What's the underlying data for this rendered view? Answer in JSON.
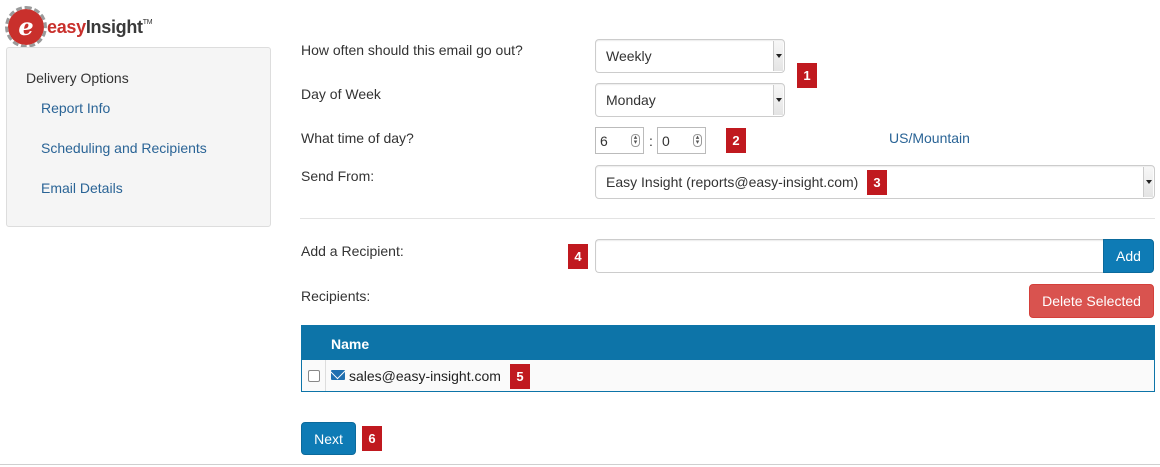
{
  "brand": {
    "logo_text": "easyInsight",
    "logo_easy": "easy",
    "logo_insight": "Insight",
    "tm": "TM"
  },
  "sidebar": {
    "heading": "Delivery Options",
    "items": [
      {
        "label": "Report Info"
      },
      {
        "label": "Scheduling and Recipients"
      },
      {
        "label": "Email Details"
      }
    ]
  },
  "form": {
    "frequency": {
      "label": "How often should this email go out?",
      "value": "Weekly"
    },
    "day_of_week": {
      "label": "Day of Week",
      "value": "Monday"
    },
    "time_of_day": {
      "label": "What time of day?",
      "hour": "6",
      "separator": ":",
      "minute": "0",
      "timezone": "US/Mountain"
    },
    "send_from": {
      "label": "Send From:",
      "value": "Easy Insight (reports@easy-insight.com)"
    },
    "add_recipient": {
      "label": "Add a Recipient:",
      "value": "",
      "button": "Add"
    },
    "recipients": {
      "label": "Recipients:",
      "delete_button": "Delete Selected"
    }
  },
  "table": {
    "columns": [
      "Name"
    ],
    "rows": [
      {
        "email": "sales@easy-insight.com",
        "icon": "mail-icon"
      }
    ]
  },
  "callouts": [
    "1",
    "2",
    "3",
    "4",
    "5",
    "6"
  ],
  "actions": {
    "next": "Next"
  },
  "colors": {
    "primary": "#0e7bb5",
    "danger": "#d9534f",
    "callout": "#c0191f",
    "link": "#2a6496"
  }
}
